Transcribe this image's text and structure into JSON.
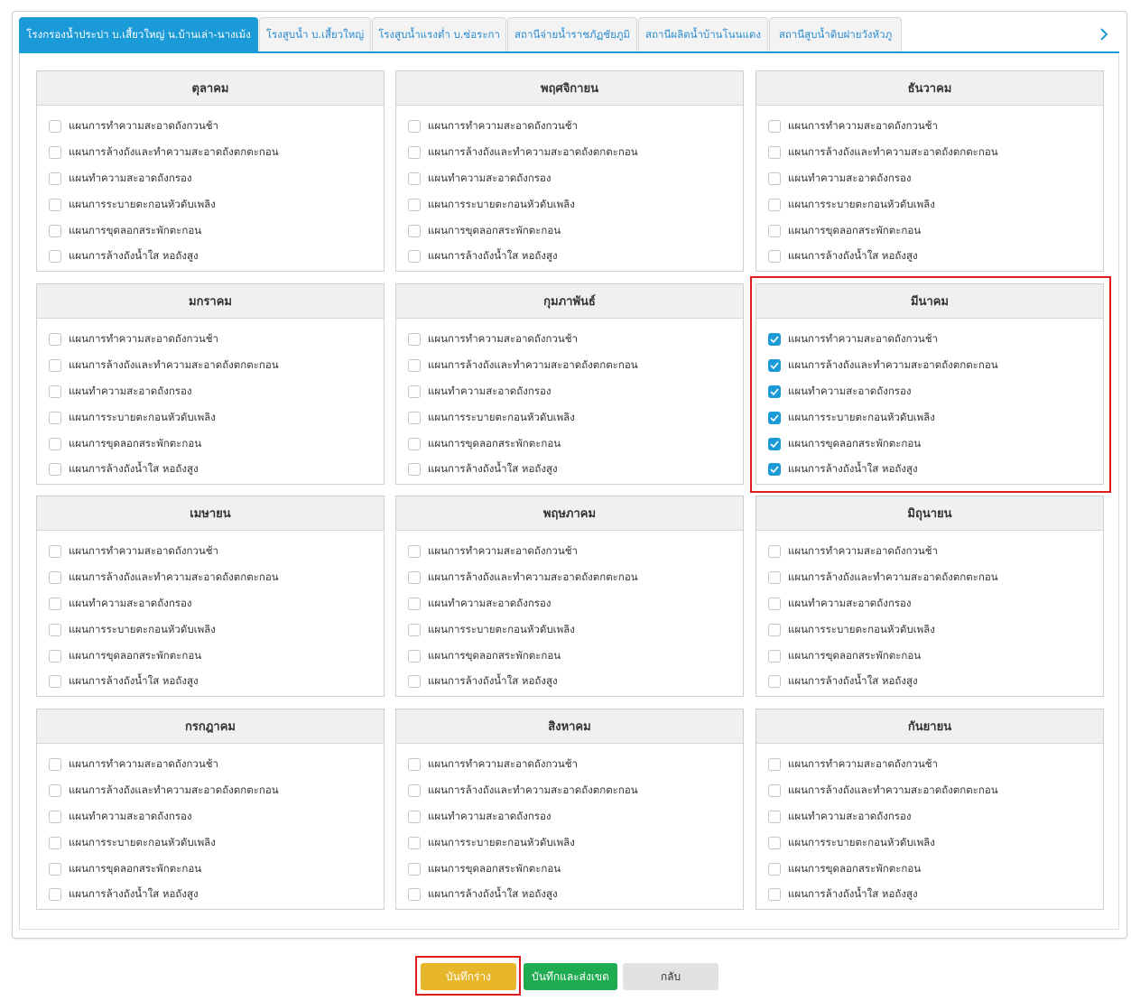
{
  "tabs": [
    {
      "label": "โรงกรองน้ำประปา บ.เสี้ยวใหญ่ น.บ้านเล่า-นางเม้ง",
      "active": true
    },
    {
      "label": "โรงสูบน้ำ บ.เสี้ยวใหญ่",
      "active": false
    },
    {
      "label": "โรงสูบน้ำแรงต่ำ บ.ซ่อระกา",
      "active": false
    },
    {
      "label": "สถานีจ่ายน้ำราชภัฏชัยภูมิ",
      "active": false
    },
    {
      "label": "สถานีผลิตน้ำบ้านโนนแดง",
      "active": false
    },
    {
      "label": "สถานีสูบน้ำดิบฝายวังหัวภู",
      "active": false
    }
  ],
  "tab_next_icon": "chevron-right-icon",
  "plan_items": [
    "แผนการทำความสะอาดถังกวนช้า",
    "แผนการล้างถังและทำความสะอาดถังตกตะกอน",
    "แผนทำความสะอาดถังกรอง",
    "แผนการระบายตะกอนหัวดับเพลิง",
    "แผนการขุดลอกสระพักตะกอน",
    "แผนการล้างถังน้ำใส หอถังสูง"
  ],
  "months": [
    {
      "name": "ตุลาคม",
      "checked": [
        false,
        false,
        false,
        false,
        false,
        false
      ]
    },
    {
      "name": "พฤศจิกายน",
      "checked": [
        false,
        false,
        false,
        false,
        false,
        false
      ]
    },
    {
      "name": "ธันวาคม",
      "checked": [
        false,
        false,
        false,
        false,
        false,
        false
      ]
    },
    {
      "name": "มกราคม",
      "checked": [
        false,
        false,
        false,
        false,
        false,
        false
      ]
    },
    {
      "name": "กุมภาพันธ์",
      "checked": [
        false,
        false,
        false,
        false,
        false,
        false
      ]
    },
    {
      "name": "มีนาคม",
      "checked": [
        true,
        true,
        true,
        true,
        true,
        true
      ]
    },
    {
      "name": "เมษายน",
      "checked": [
        false,
        false,
        false,
        false,
        false,
        false
      ]
    },
    {
      "name": "พฤษภาคม",
      "checked": [
        false,
        false,
        false,
        false,
        false,
        false
      ]
    },
    {
      "name": "มิถุนายน",
      "checked": [
        false,
        false,
        false,
        false,
        false,
        false
      ]
    },
    {
      "name": "กรกฎาคม",
      "checked": [
        false,
        false,
        false,
        false,
        false,
        false
      ]
    },
    {
      "name": "สิงหาคม",
      "checked": [
        false,
        false,
        false,
        false,
        false,
        false
      ]
    },
    {
      "name": "กันยายน",
      "checked": [
        false,
        false,
        false,
        false,
        false,
        false
      ]
    }
  ],
  "buttons": {
    "save_draft": "บันทึกร่าง",
    "save_send": "บันทึกและส่งเขต",
    "back": "กลับ"
  },
  "colors": {
    "accent": "#1a9ad6",
    "draft": "#e8b62b",
    "send": "#1fab4f",
    "highlight": "#e01b1b"
  }
}
